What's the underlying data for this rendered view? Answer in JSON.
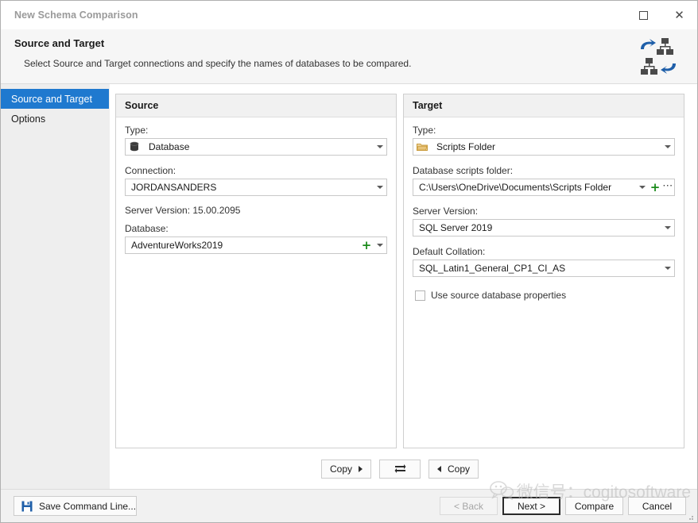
{
  "window": {
    "title": "New Schema Comparison",
    "buttons": {
      "maximize": "maximize-button",
      "close": "close-button"
    }
  },
  "header": {
    "title": "Source and Target",
    "subtitle": "Select Source and Target connections and specify the names of databases to be compared.",
    "icon": "schema-comparison-icon"
  },
  "sidebar": {
    "items": [
      {
        "label": "Source and Target",
        "active": true
      },
      {
        "label": "Options",
        "active": false
      }
    ]
  },
  "source": {
    "panel_title": "Source",
    "type_label": "Type:",
    "type_value": "Database",
    "type_icon": "database-icon",
    "connection_label": "Connection:",
    "connection_value": "JORDANSANDERS",
    "server_version_text": "Server Version: 15.00.2095",
    "database_label": "Database:",
    "database_value": "AdventureWorks2019",
    "add_symbol": "+"
  },
  "target": {
    "panel_title": "Target",
    "type_label": "Type:",
    "type_value": "Scripts Folder",
    "type_icon": "folder-icon",
    "scripts_folder_label": "Database scripts folder:",
    "scripts_folder_value": "C:\\Users\\OneDrive\\Documents\\Scripts Folder",
    "server_version_label": "Server Version:",
    "server_version_value": "SQL Server 2019",
    "collation_label": "Default Collation:",
    "collation_value": "SQL_Latin1_General_CP1_CI_AS",
    "use_source_props_label": "Use source database properties",
    "use_source_props_checked": false,
    "add_symbol": "+",
    "more_symbol": "⋯"
  },
  "middle_actions": {
    "copy_right_label": "Copy",
    "swap_label": "swap-icon",
    "copy_left_label": "Copy"
  },
  "footer": {
    "save_command_line_label": "Save Command Line...",
    "save_icon": "floppy-disk-icon",
    "back_label": "< Back",
    "back_disabled": true,
    "next_label": "Next >",
    "next_focused": true,
    "compare_label": "Compare",
    "cancel_label": "Cancel"
  },
  "watermark": {
    "text": "微信号：cogitosoftware",
    "icon": "wechat-icon"
  },
  "colors": {
    "accent": "#1f79cf",
    "header_bg": "#f6f6f6",
    "panel_head_bg": "#f1f1f1",
    "plus_green": "#1a8a1a",
    "folder_orange": "#d9a441",
    "icon_blue": "#1f5fa9",
    "icon_dark": "#4a4a4a"
  }
}
